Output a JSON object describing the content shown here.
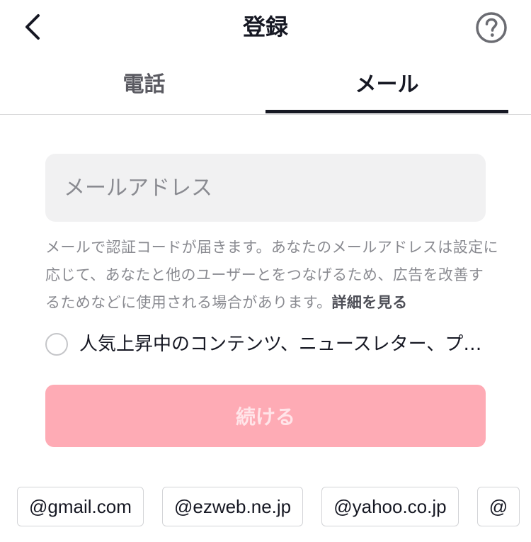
{
  "header": {
    "title": "登録",
    "back_icon": "chevron-left-icon",
    "help_icon": "question-circle-icon"
  },
  "tabs": [
    {
      "label": "電話",
      "active": false
    },
    {
      "label": "メール",
      "active": true
    }
  ],
  "email_field": {
    "placeholder": "メールアドレス",
    "value": ""
  },
  "notice": {
    "text": "メールで認証コードが届きます。あなたのメールアドレスは設定に応じて、あなたと他のユーザーとをつなげるため、広告を改善するためなどに使用される場合があります。",
    "link_label": "詳細を見る"
  },
  "consent": {
    "checked": false,
    "label": "人気上昇中のコンテンツ、ニュースレター、プロモーション、おすすめ、アカウントの更新情報をメールで受け取る"
  },
  "continue_button": {
    "label": "続ける",
    "enabled": false
  },
  "email_suggestions": [
    "@gmail.com",
    "@ezweb.ne.jp",
    "@yahoo.co.jp",
    "@"
  ],
  "colors": {
    "accent_disabled": "#feabb5",
    "text_primary": "#161823",
    "text_secondary": "#8a8b91"
  }
}
